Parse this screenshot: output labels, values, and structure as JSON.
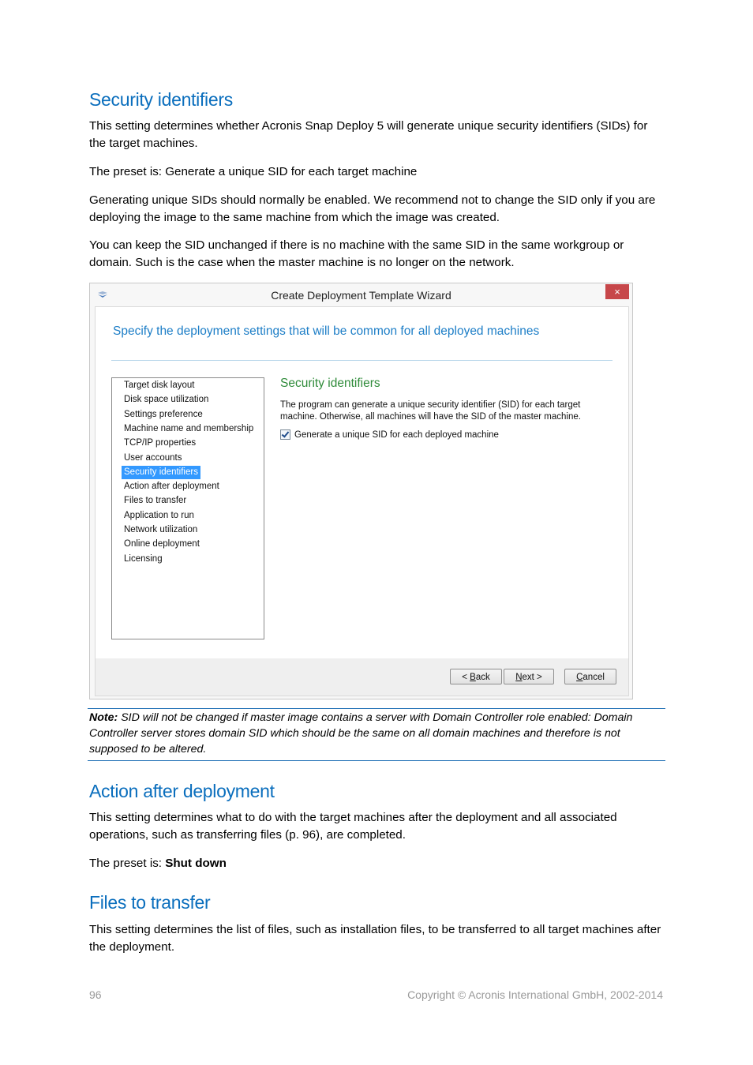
{
  "sections": {
    "security": {
      "title": "Security identifiers",
      "p1": "This setting determines whether Acronis Snap Deploy 5 will generate unique security identifiers (SIDs) for the target machines.",
      "p2": "The preset is: Generate a unique SID for each target machine",
      "p3": "Generating unique SIDs should normally be enabled. We recommend not to change the SID only if you are deploying the image to the same machine from which the image was created.",
      "p4": "You can keep the SID unchanged if there is no machine with the same SID in the same workgroup or domain. Such is the case when the master machine is no longer on the network."
    },
    "note": {
      "label": "Note:",
      "text": " SID will not be changed if master image contains a server with Domain Controller role enabled: Domain Controller server stores domain SID which should be the same on all domain machines and therefore is not supposed to be altered."
    },
    "action": {
      "title": "Action after deployment",
      "p1": "This setting determines what to do with the target machines after the deployment and all associated operations, such as transferring files (p. 96), are completed.",
      "preset_prefix": "The preset is: ",
      "preset_value": "Shut down"
    },
    "files": {
      "title": "Files to transfer",
      "p1": "This setting determines the list of files, such as installation files, to be transferred to all target machines after the deployment."
    }
  },
  "wizard": {
    "icon": "wizard-app-icon",
    "title": "Create Deployment Template Wizard",
    "close_label": "×",
    "heading": "Specify the deployment settings that will be common for all deployed machines",
    "nav_items": [
      "Target disk layout",
      "Disk space utilization",
      "Settings preference",
      "Machine name and membership",
      "TCP/IP properties",
      "User accounts",
      "Security identifiers",
      "Action after deployment",
      "Files to transfer",
      "Application to run",
      "Network utilization",
      "Online deployment",
      "Licensing"
    ],
    "selected_index": 6,
    "panel_title": "Security identifiers",
    "panel_desc": "The program can generate a unique security identifier (SID) for each target machine. Otherwise, all machines will have the SID of the master machine.",
    "checkbox_label": "Generate a unique SID for each deployed machine",
    "checkbox_checked": true,
    "buttons": {
      "back_prefix": "< ",
      "back_mnemonic": "B",
      "back_rest": "ack",
      "next_mnemonic": "N",
      "next_rest": "ext >",
      "cancel_mnemonic": "C",
      "cancel_rest": "ancel"
    }
  },
  "page_footer": {
    "page_number": "96",
    "copyright": "Copyright © Acronis International GmbH, 2002-2014"
  },
  "colors": {
    "heading_blue": "#0a6ebd",
    "panel_title_green": "#2f8b3a",
    "selection_blue": "#3399ff",
    "close_red": "#c7474a",
    "note_rule": "#1f6fb5"
  }
}
